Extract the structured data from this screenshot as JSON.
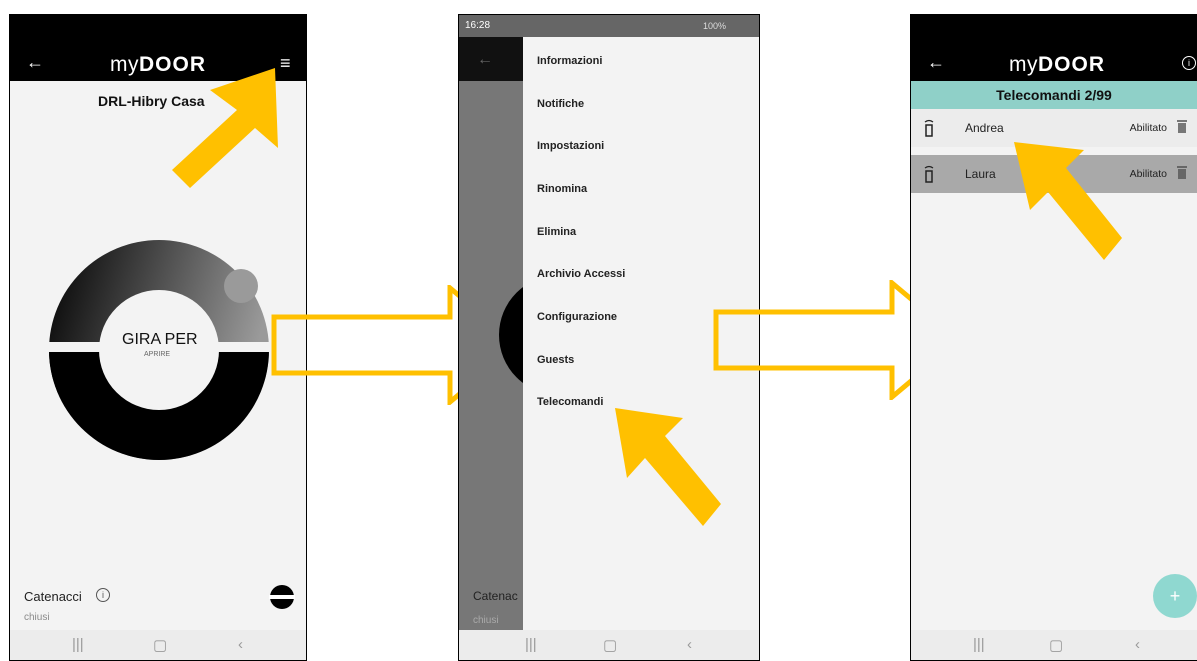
{
  "screen1": {
    "title": "DRL-Hibry Casa",
    "logo_light": "my",
    "logo_bold": "DOOR",
    "dial_main": "GIRA PER",
    "dial_sub": "APRIRE",
    "bolts_label": "Catenacci",
    "bolts_state": "chiusi"
  },
  "screen2": {
    "time": "16:28",
    "battery": "100%",
    "menu": [
      "Informazioni",
      "Notifiche",
      "Impostazioni",
      "Rinomina",
      "Elimina",
      "Archivio Accessi",
      "Configurazione",
      "Guests",
      "Telecomandi"
    ],
    "behind_label": "Catenac",
    "behind_state": "chiusi"
  },
  "screen3": {
    "logo_light": "my",
    "logo_bold": "DOOR",
    "list_title": "Telecomandi 2/99",
    "remotes": [
      {
        "name": "Andrea",
        "status": "Abilitato"
      },
      {
        "name": "Laura",
        "status": "Abilitato"
      }
    ],
    "fab": "+"
  },
  "colors": {
    "highlight": "#ffc000",
    "teal_header": "#8fd0c8",
    "fab": "#8fd8d0",
    "selected_row": "#a9a9a9"
  },
  "icons": [
    "back-arrow-icon",
    "hamburger-menu-icon",
    "info-icon",
    "remote-control-icon",
    "trash-icon",
    "bolt-closed-icon",
    "plus-icon",
    "recents-icon",
    "home-icon",
    "back-nav-icon"
  ]
}
